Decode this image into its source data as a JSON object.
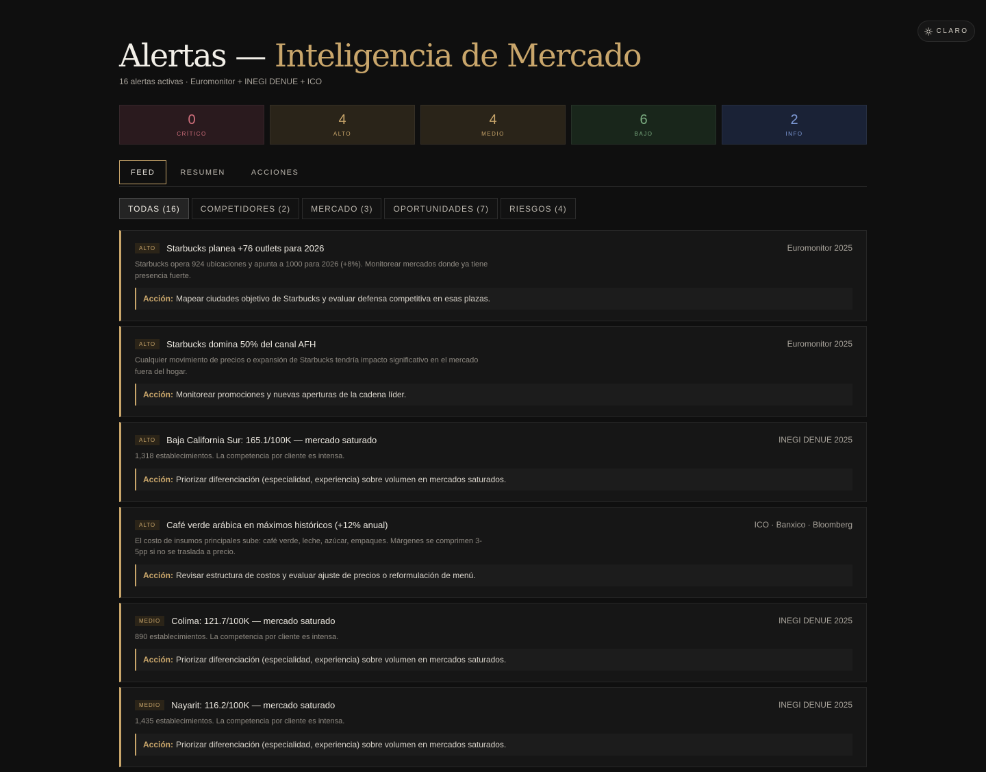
{
  "theme_toggle": {
    "label": "CLARO",
    "icon": "sun-icon"
  },
  "header": {
    "title_main": "Alertas —",
    "title_accent": "Inteligencia de Mercado",
    "subtitle": "16 alertas activas · Euromonitor + INEGI DENUE + ICO"
  },
  "stats": [
    {
      "value": "0",
      "label": "CRÍTICO",
      "color": "#d2707d",
      "bg": "#2a1a1e"
    },
    {
      "value": "4",
      "label": "ALTO",
      "color": "#c9a66b",
      "bg": "#2a2419"
    },
    {
      "value": "4",
      "label": "MEDIO",
      "color": "#c9a66b",
      "bg": "#2a2419"
    },
    {
      "value": "6",
      "label": "BAJO",
      "color": "#7cae82",
      "bg": "#19261b"
    },
    {
      "value": "2",
      "label": "INFO",
      "color": "#7f9bd8",
      "bg": "#1a2236"
    }
  ],
  "tabs": [
    "FEED",
    "RESUMEN",
    "ACCIONES"
  ],
  "filters": [
    "TODAS (16)",
    "COMPETIDORES (2)",
    "MERCADO (3)",
    "OPORTUNIDADES (7)",
    "RIESGOS (4)"
  ],
  "action_label": "Acción:",
  "alerts": [
    {
      "level": "ALTO",
      "title": "Starbucks planea +76 outlets para 2026",
      "source": "Euromonitor 2025",
      "desc": "Starbucks opera 924 ubicaciones y apunta a 1000 para 2026 (+8%). Monitorear mercados donde ya tiene presencia fuerte.",
      "action": "Mapear ciudades objetivo de Starbucks y evaluar defensa competitiva en esas plazas."
    },
    {
      "level": "ALTO",
      "title": "Starbucks domina 50% del canal AFH",
      "source": "Euromonitor 2025",
      "desc": "Cualquier movimiento de precios o expansión de Starbucks tendría impacto significativo en el mercado fuera del hogar.",
      "action": "Monitorear promociones y nuevas aperturas de la cadena líder."
    },
    {
      "level": "ALTO",
      "title": "Baja California Sur: 165.1/100K — mercado saturado",
      "source": "INEGI DENUE 2025",
      "desc": "1,318 establecimientos. La competencia por cliente es intensa.",
      "action": "Priorizar diferenciación (especialidad, experiencia) sobre volumen en mercados saturados."
    },
    {
      "level": "ALTO",
      "title": "Café verde arábica en máximos históricos (+12% anual)",
      "source": "ICO · Banxico · Bloomberg",
      "desc": "El costo de insumos principales sube: café verde, leche, azúcar, empaques. Márgenes se comprimen 3-5pp si no se traslada a precio.",
      "action": "Revisar estructura de costos y evaluar ajuste de precios o reformulación de menú."
    },
    {
      "level": "MEDIO",
      "title": "Colima: 121.7/100K — mercado saturado",
      "source": "INEGI DENUE 2025",
      "desc": "890 establecimientos. La competencia por cliente es intensa.",
      "action": "Priorizar diferenciación (especialidad, experiencia) sobre volumen en mercados saturados."
    },
    {
      "level": "MEDIO",
      "title": "Nayarit: 116.2/100K — mercado saturado",
      "source": "INEGI DENUE 2025",
      "desc": "1,435 establecimientos. La competencia por cliente es intensa.",
      "action": "Priorizar diferenciación (especialidad, experiencia) sobre volumen en mercados saturados."
    }
  ]
}
